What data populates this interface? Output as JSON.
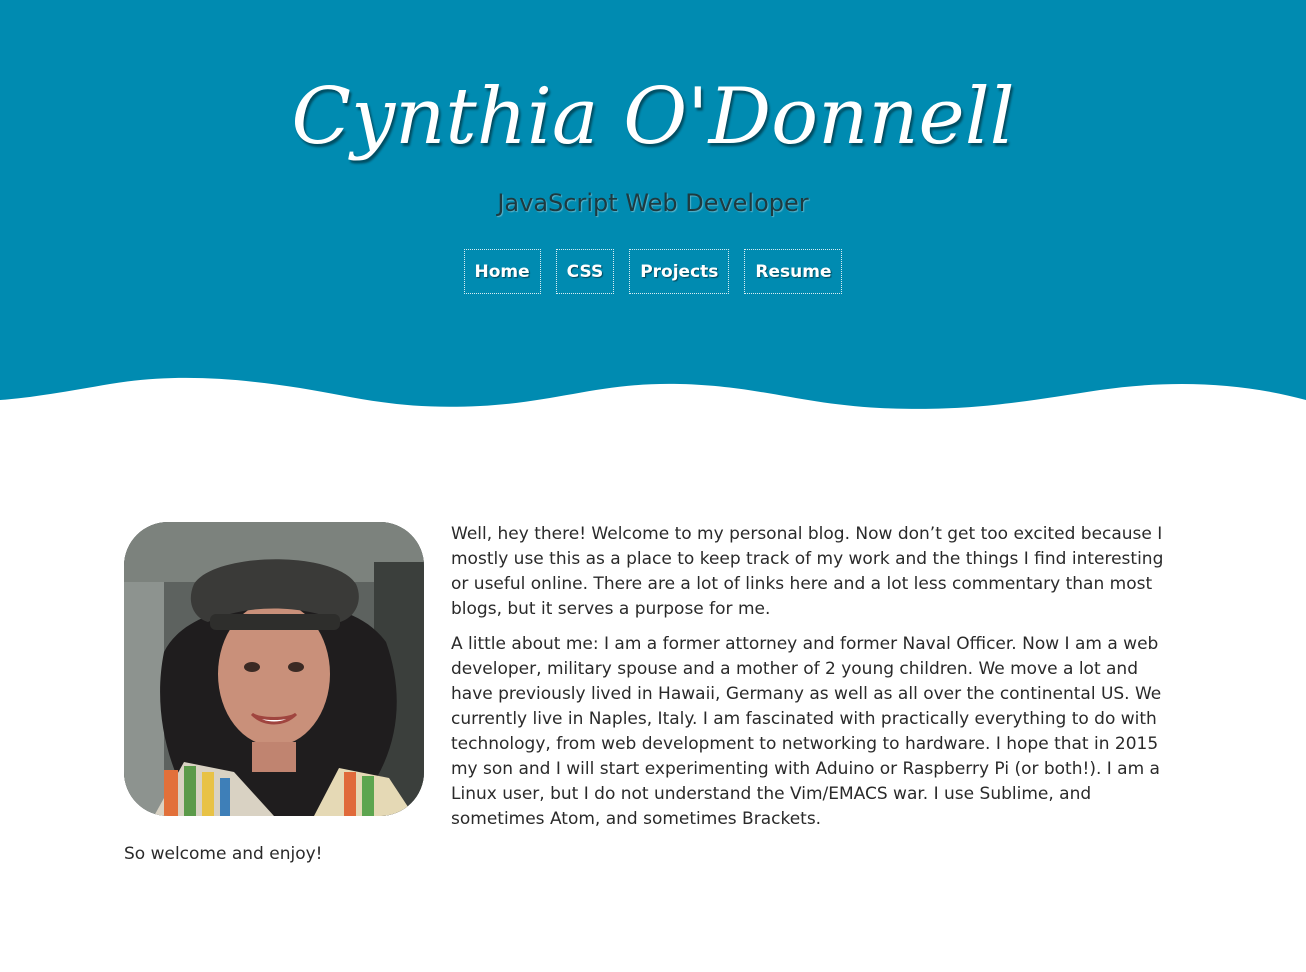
{
  "header": {
    "title": "Cynthia O'Donnell",
    "subtitle": "JavaScript Web Developer",
    "bg_color": "#008bb1"
  },
  "nav": {
    "items": [
      {
        "label": "Home"
      },
      {
        "label": "CSS"
      },
      {
        "label": "Projects"
      },
      {
        "label": "Resume"
      }
    ]
  },
  "main": {
    "avatar_icon": "profile-photo",
    "paragraphs": [
      "Well, hey there!  Welcome to my personal blog.  Now don’t get too excited because I mostly use this as a place to keep track of my work and the things I find interesting or useful online.  There are a lot of links here and a lot less commentary than most blogs, but it serves a purpose for me.",
      "A little about me:  I am a former attorney and former Naval Officer.  Now I am a web developer, military spouse and a mother of 2 young children.  We move a lot and have previously lived in Hawaii, Germany as well as all over the continental US.  We currently live in Naples, Italy.  I am fascinated with practically everything to do with technology, from web development to networking to hardware.  I hope that in 2015 my son and I will start experimenting with Aduino or Raspberry Pi (or both!).  I am a Linux user, but I do not understand the Vim/EMACS war.  I use Sublime, and sometimes Atom, and sometimes Brackets.",
      "So welcome and enjoy!"
    ]
  }
}
